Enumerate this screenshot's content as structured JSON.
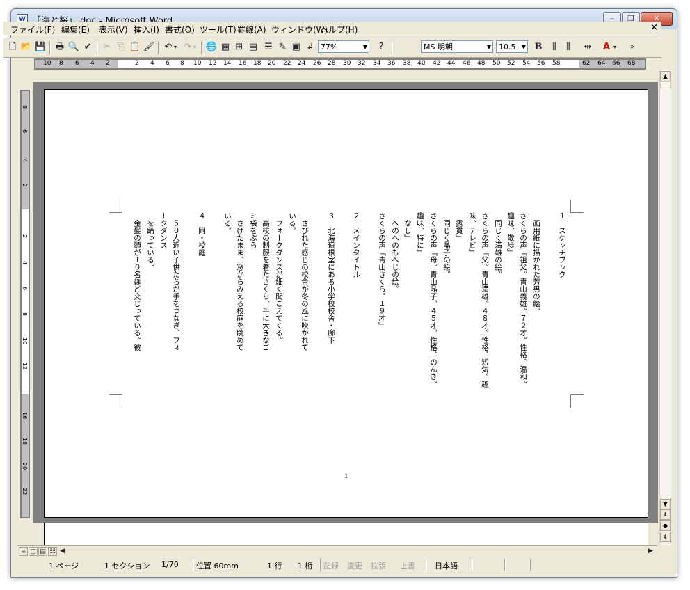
{
  "window": {
    "title": "「海と桜」.doc - Microsoft Word",
    "app_icon": "W",
    "minimize": "‒",
    "restore": "❐",
    "close": "✕"
  },
  "menu": {
    "items": [
      "ファイル(F)",
      "編集(E)",
      "表示(V)",
      "挿入(I)",
      "書式(O)",
      "ツール(T)",
      "罫線(A)",
      "ウィンドウ(W)",
      "ヘルプ(H)"
    ],
    "close_doc": "×"
  },
  "toolbar": {
    "zoom": "77%",
    "font_name": "MS 明朝",
    "font_size": "10.5",
    "bold": "B",
    "font_color_label": "A"
  },
  "ruler": {
    "h_left": [
      "10",
      "8",
      "6",
      "4",
      "2"
    ],
    "h_main": [
      "2",
      "4",
      "6",
      "8",
      "10",
      "12",
      "14",
      "16",
      "18",
      "20",
      "22",
      "24",
      "26",
      "28",
      "30",
      "32",
      "34",
      "36",
      "38",
      "40",
      "42",
      "44",
      "46",
      "48",
      "50",
      "52",
      "54",
      "56",
      "58"
    ],
    "h_right": [
      "62",
      "64",
      "66",
      "68"
    ],
    "v_top": [
      "8",
      "6",
      "4",
      "2"
    ],
    "v_main": [
      "2",
      "4",
      "6",
      "8",
      "10",
      "12"
    ],
    "v_bottom": [
      "16",
      "18",
      "20",
      "22"
    ]
  },
  "document": {
    "columns": [
      "１　スケッチブック",
      "　画用紙に描かれた芳男の絵。",
      "さくらの声「祖父。青山義雄。７２才。性格、温和。",
      "趣味、散歩」",
      "　同じく満雄の絵。",
      "さくらの声「父。青山満雄。４８才。性格、短気。趣",
      "味、テレビ」",
      "　露貫」",
      "　同じく晶子の絵。",
      "さくらの声「母。青山晶子。４５才。性格、のんき。",
      "趣味、特に」",
      "　なし」",
      "　へのへのもへじの絵。",
      "さくらの声「青山さくら。１９才」",
      "",
      "２　メインタイトル",
      "",
      "３　北海道根室にある小学校校舎・廊下",
      "　さびれた感じの校舎が冬の風に吹かれて",
      "いる。",
      "",
      "　フォークダンスが細く聞こえてくる。",
      "　高校の制服を着たさくら、手に大きなゴ",
      "ミ袋をぶら",
      "　さげたまま、窓からみえる校庭を眺めて",
      "いる。",
      "",
      "４　同・校庭",
      "",
      "　５０人近い子供たちが手をつなぎ、フォ",
      "ークダンス",
      "　を踊っている。",
      "　金髪の頭が１０名ほど交じっている。彼"
    ],
    "page_number": "1"
  },
  "status": {
    "page": "1 ページ",
    "section": "1 セクション",
    "pages": "1/70",
    "position": "位置 60mm",
    "line": "1 行",
    "column": "1 桁",
    "rec": "記録",
    "trk": "変更",
    "ext": "拡張",
    "ovr": "上書",
    "language": "日本語"
  }
}
